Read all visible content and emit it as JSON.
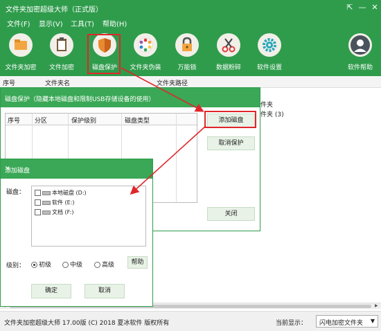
{
  "app": {
    "title": "文件夹加密超级大师（正式版）"
  },
  "window_controls": {
    "restore": "⇱",
    "minimize": "—",
    "close": "✕"
  },
  "menu": [
    "文件(F)",
    "显示(V)",
    "工具(T)",
    "帮助(H)"
  ],
  "toolbar": [
    {
      "label": "文件夹加密",
      "icon": "folder-icon",
      "color": "#f2a540"
    },
    {
      "label": "文件加密",
      "icon": "clipboard-icon",
      "color": "#7a5b3a"
    },
    {
      "label": "磁盘保护",
      "icon": "shield-icon",
      "color": "#e98a2f"
    },
    {
      "label": "文件夹伪装",
      "icon": "palette-icon",
      "color": "#ffffff"
    },
    {
      "label": "万能锁",
      "icon": "lock-icon",
      "color": "#f2a540"
    },
    {
      "label": "数据粉碎",
      "icon": "scissors-icon",
      "color": "#e23c3c"
    },
    {
      "label": "软件设置",
      "icon": "gear-icon",
      "color": "#27a7b8"
    },
    {
      "label": "软件帮助",
      "icon": "user-icon",
      "color": "#5a6470"
    }
  ],
  "list": {
    "columns": [
      "序号",
      "文件夹名",
      "文件夹路径"
    ],
    "rows": [
      "件夹",
      "件夹 (3)"
    ]
  },
  "disk_protect_dialog": {
    "title": "磁盘保护（隐藏本地磁盘和限制USB存储设备的使用）",
    "columns": [
      "序号",
      "分区",
      "保护级别",
      "磁盘类型"
    ],
    "buttons": {
      "add": "添加磁盘",
      "cancel_protect": "取消保护",
      "close": "关闭"
    }
  },
  "add_disk_dialog": {
    "title": "添加磁盘",
    "close": "✕",
    "disk_label": "磁盘：",
    "disks": [
      "本地磁盘 (D:)",
      "软件 (E:)",
      "文档 (F:)"
    ],
    "level_label": "级别：",
    "levels": [
      "初级",
      "中级",
      "高级"
    ],
    "selected_level": "初级",
    "buttons": {
      "help": "帮助",
      "ok": "确定",
      "cancel": "取消"
    }
  },
  "status": {
    "text": "文件夹加密超级大师 17.00版 (C) 2018  夏冰软件 版权所有",
    "display_label": "当前显示：",
    "display_value": "闪电加密文件夹"
  },
  "colors": {
    "brand_green": "#2f9c4c",
    "dialog_green": "#3aa856",
    "highlight_red": "#e0262b"
  }
}
